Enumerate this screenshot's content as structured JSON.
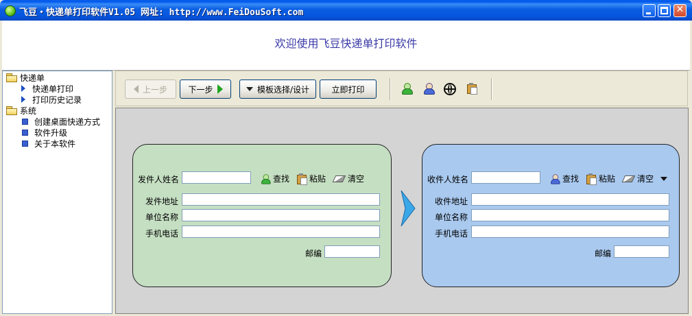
{
  "window": {
    "title": "飞豆・快递单打印软件V1.05  网址: http://www.FeiDouSoft.com"
  },
  "banner": {
    "text": "欢迎使用飞豆快递单打印软件"
  },
  "tree": {
    "groups": [
      {
        "label": "快递单",
        "items": [
          "快递单打印",
          "打印历史记录"
        ]
      },
      {
        "label": "系统",
        "items": [
          "创建桌面快递方式",
          "软件升级",
          "关于本软件"
        ]
      }
    ]
  },
  "toolbar": {
    "prev_label": "上一步",
    "next_label": "下一步",
    "template_label": "模板选择/设计",
    "print_label": "立即打印"
  },
  "sender": {
    "name_label": "发件人姓名",
    "name_value": "",
    "find_label": "查找",
    "paste_label": "粘贴",
    "clear_label": "清空",
    "address_label": "发件地址",
    "address_value": "",
    "company_label": "单位名称",
    "company_value": "",
    "phone_label": "手机电话",
    "phone_value": "",
    "zip_label": "邮编",
    "zip_value": ""
  },
  "receiver": {
    "name_label": "收件人姓名",
    "name_value": "",
    "find_label": "查找",
    "paste_label": "粘贴",
    "clear_label": "清空",
    "address_label": "收件地址",
    "address_value": "",
    "company_label": "单位名称",
    "company_value": "",
    "phone_label": "手机电话",
    "phone_value": "",
    "zip_label": "邮编",
    "zip_value": ""
  }
}
